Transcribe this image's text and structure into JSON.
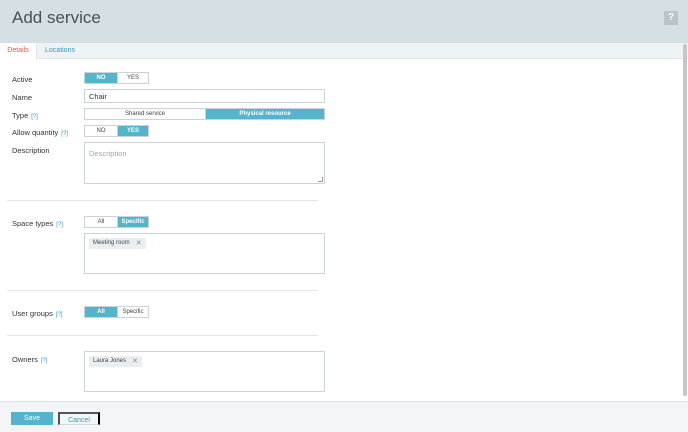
{
  "header": {
    "title": "Add service",
    "help_label": "?"
  },
  "tabs": [
    {
      "label": "Details",
      "active": true
    },
    {
      "label": "Locations",
      "active": false
    }
  ],
  "form": {
    "active": {
      "label": "Active",
      "options": [
        "NO",
        "YES"
      ],
      "selected": "NO"
    },
    "name": {
      "label": "Name",
      "value": "Chair"
    },
    "type": {
      "label": "Type",
      "hint": "[?]",
      "options": [
        "Shared service",
        "Physical resource"
      ],
      "selected": "Physical resource"
    },
    "allow_quantity": {
      "label": "Allow quantity",
      "hint": "[?]",
      "options": [
        "NO",
        "YES"
      ],
      "selected": "YES"
    },
    "description": {
      "label": "Description",
      "placeholder": "Description"
    },
    "space_types": {
      "label": "Space types",
      "hint": "[?]",
      "options": [
        "All",
        "Specific"
      ],
      "selected": "Specific",
      "tags": [
        {
          "label": "Meeting room"
        }
      ]
    },
    "user_groups": {
      "label": "User groups",
      "hint": "[?]",
      "options": [
        "All",
        "Specific"
      ],
      "selected": "All"
    },
    "owners": {
      "label": "Owners",
      "hint": "[?]",
      "tags": [
        {
          "label": "Laura Jones"
        }
      ]
    }
  },
  "footer": {
    "save_label": "Save",
    "cancel_label": "Cancel"
  },
  "colors": {
    "accent": "#53b4cc",
    "link": "#2b9bbd",
    "active_tab": "#d9534f",
    "header_bg": "#d5e0e5"
  }
}
